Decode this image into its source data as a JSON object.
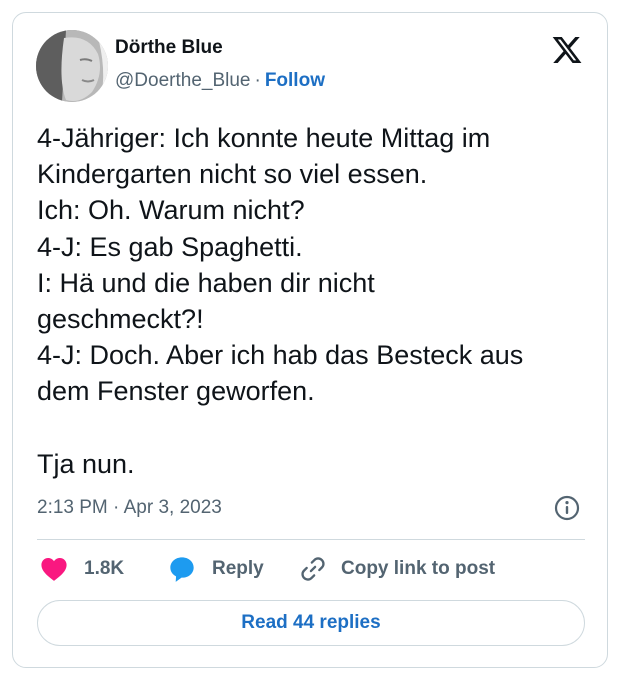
{
  "author": {
    "name": "Dörthe Blue",
    "handle": "@Doerthe_Blue",
    "separator": "·",
    "follow_label": "Follow"
  },
  "tweet": {
    "text": "4-Jähriger: Ich konnte heute Mittag im\nKindergarten nicht so viel essen.\nIch: Oh. Warum nicht?\n4-J: Es gab Spaghetti.\nI: Hä und die haben dir nicht\ngeschmeckt?!\n4-J: Doch. Aber ich hab das Besteck aus\ndem Fenster geworfen.\n\nTja nun.",
    "time": "2:13 PM · Apr 3, 2023"
  },
  "actions": {
    "likes": "1.8K",
    "reply_label": "Reply",
    "copy_link_label": "Copy link to post"
  },
  "read_replies_label": "Read 44 replies",
  "icons": {
    "brand": "x-logo-icon",
    "info": "info-icon",
    "like": "heart-icon",
    "reply": "speech-bubble-icon",
    "copy": "link-icon"
  },
  "colors": {
    "like": "#f91880",
    "reply": "#1d9bf0",
    "link": "#1d6fc4",
    "muted": "#536471",
    "border": "#cfd9de"
  }
}
